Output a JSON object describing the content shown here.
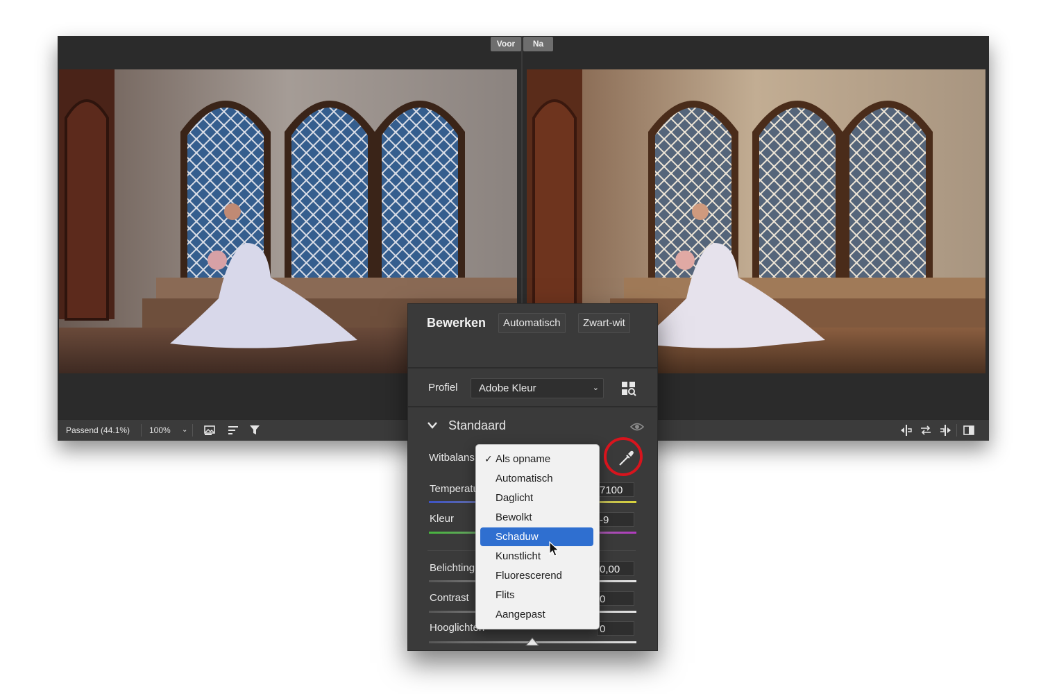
{
  "view_toggle": {
    "before": "Voor",
    "after": "Na"
  },
  "toolbar": {
    "zoom_fit": "Passend (44.1%)",
    "zoom_level": "100%",
    "icons": [
      "image-preview-icon",
      "sort-icon",
      "filter-icon",
      "before-after-left-icon",
      "swap-icon",
      "before-after-right-icon",
      "compare-icon"
    ]
  },
  "panel": {
    "title": "Bewerken",
    "auto_button": "Automatisch",
    "bw_button": "Zwart-wit",
    "profile_label": "Profiel",
    "profile_value": "Adobe Kleur",
    "section_title": "Standaard",
    "rows": [
      {
        "label": "Witbalans",
        "value": ""
      },
      {
        "label": "Temperatuur",
        "value": "7100"
      },
      {
        "label": "Kleur",
        "value": "-9"
      },
      {
        "label": "Belichting",
        "value": "0,00"
      },
      {
        "label": "Contrast",
        "value": "0"
      },
      {
        "label": "Hooglichten",
        "value": "0"
      }
    ]
  },
  "white_balance_menu": {
    "items": [
      "Als opname",
      "Automatisch",
      "Daglicht",
      "Bewolkt",
      "Schaduw",
      "Kunstlicht",
      "Fluorescerend",
      "Flits",
      "Aangepast"
    ],
    "checked": "Als opname",
    "highlighted": "Schaduw"
  },
  "colors": {
    "menu_highlight": "#2f6fd0",
    "annotation_ring": "#d8141d",
    "panel_bg": "#3a3a3a"
  }
}
